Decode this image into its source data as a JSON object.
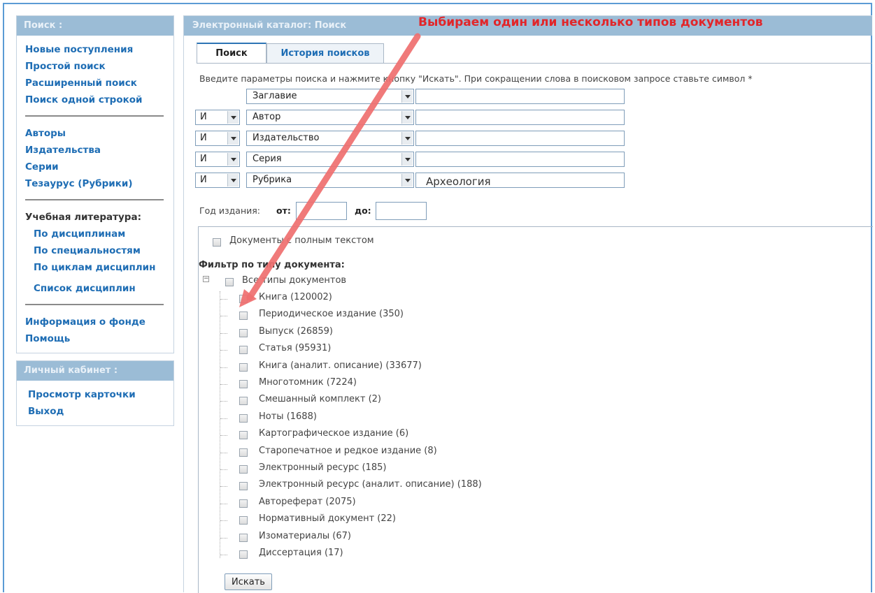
{
  "sidebar": {
    "search_title": "Поиск :",
    "search_links": [
      "Новые поступления",
      "Простой поиск",
      "Расширенный поиск",
      "Поиск одной строкой"
    ],
    "index_links": [
      "Авторы",
      "Издательства",
      "Серии",
      "Тезаурус (Рубрики)"
    ],
    "edu_heading": "Учебная литература:",
    "edu_links": [
      "По дисциплинам",
      "По специальностям",
      "По циклам дисциплин"
    ],
    "disc_list": "Список дисциплин",
    "info_links": [
      "Информация о фонде",
      "Помощь"
    ],
    "cabinet_title": "Личный кабинет :",
    "cabinet_links": [
      "Просмотр карточки",
      "Выход"
    ]
  },
  "main": {
    "title": "Электронный каталог: Поиск",
    "tabs": [
      "Поиск",
      "История поисков"
    ],
    "hint": "Введите параметры поиска и нажмите кнопку \"Искать\". При сокращении слова в поисковом запросе ставьте символ *",
    "rows": [
      {
        "op": "",
        "field": "Заглавие",
        "value": ""
      },
      {
        "op": "И",
        "field": "Автор",
        "value": ""
      },
      {
        "op": "И",
        "field": "Издательство",
        "value": ""
      },
      {
        "op": "И",
        "field": "Серия",
        "value": ""
      },
      {
        "op": "И",
        "field": "Рубрика",
        "value": "Археология"
      }
    ],
    "year_label": "Год издания:",
    "from_label": "от:",
    "to_label": "до:",
    "fulltext_label": "Документы с полным текстом",
    "filter_title": "Фильтр по типу документа:",
    "all_types": "Все типы документов",
    "doc_types": [
      "Книга (120002)",
      "Периодическое издание (350)",
      "Выпуск (26859)",
      "Статья (95931)",
      "Книга (аналит. описание) (33677)",
      "Многотомник (7224)",
      "Смешанный комплект (2)",
      "Ноты (1688)",
      "Картографическое издание (6)",
      "Старопечатное и редкое издание (8)",
      "Электронный ресурс (185)",
      "Электронный ресурс (аналит. описание) (188)",
      "Автореферат (2075)",
      "Нормативный документ (22)",
      "Изоматериалы (67)",
      "Диссертация (17)"
    ],
    "search_button": "Искать"
  },
  "annotation": "Выбираем один или несколько типов документов",
  "colors": {
    "annotation": "#e1262a",
    "arrow": "#ef6f6f",
    "link": "#1e6db4",
    "header": "#9bbcd6"
  }
}
